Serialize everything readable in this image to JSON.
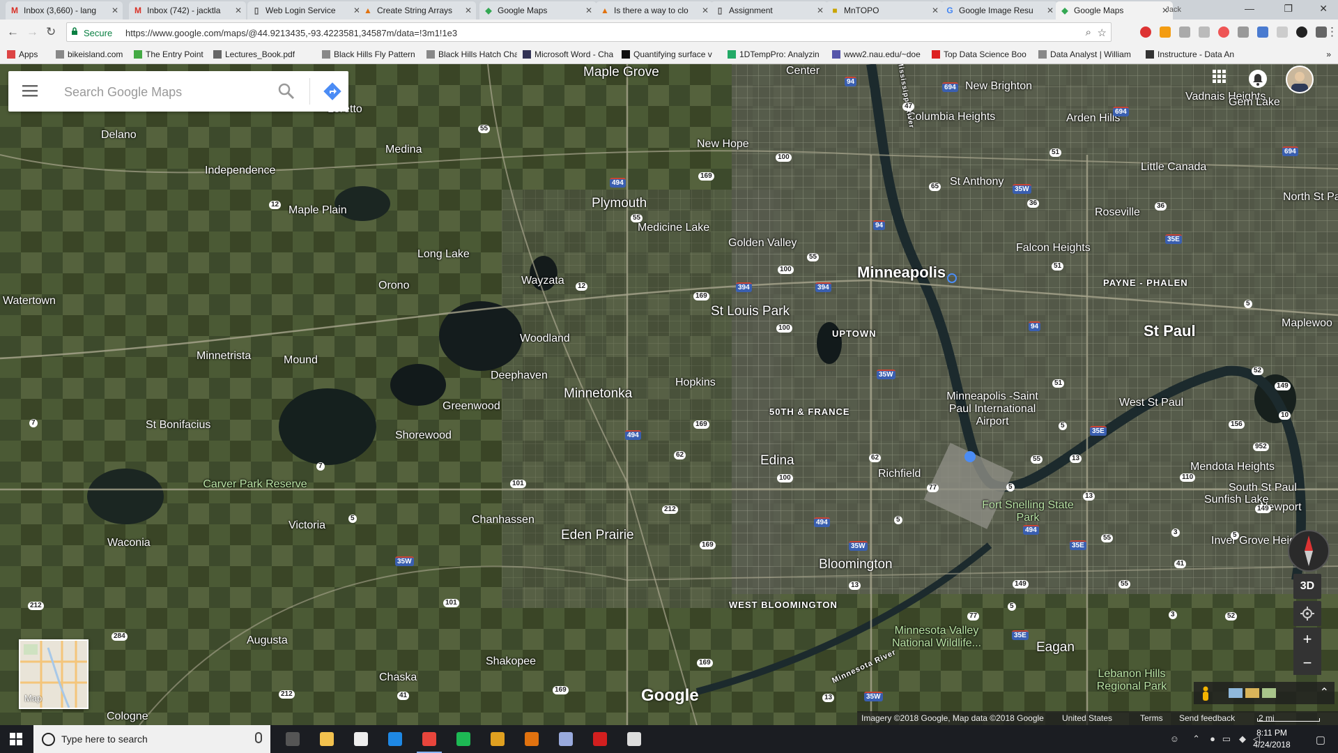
{
  "tabs": [
    {
      "title": "Inbox (3,660) - lang",
      "favicon": "gmail-icon",
      "fav_glyph": "M",
      "fav_color": "#d93025"
    },
    {
      "title": "Inbox (742) - jacktla",
      "favicon": "gmail-icon",
      "fav_glyph": "M",
      "fav_color": "#d93025"
    },
    {
      "title": "Web Login Service",
      "favicon": "page-icon",
      "fav_glyph": "▯",
      "fav_color": "#555"
    },
    {
      "title": "Create String Arrays",
      "favicon": "matlab-icon",
      "fav_glyph": "▲",
      "fav_color": "#e1720f"
    },
    {
      "title": "Google Maps",
      "favicon": "maps-icon",
      "fav_glyph": "◆",
      "fav_color": "#34a853"
    },
    {
      "title": "Is there a way to clo",
      "favicon": "matlab-icon",
      "fav_glyph": "▲",
      "fav_color": "#e1720f"
    },
    {
      "title": "Assignment",
      "favicon": "page-icon",
      "fav_glyph": "▯",
      "fav_color": "#555"
    },
    {
      "title": "MnTOPO",
      "favicon": "mntopo-icon",
      "fav_glyph": "■",
      "fav_color": "#c9a400"
    },
    {
      "title": "Google Image Resu",
      "favicon": "google-icon",
      "fav_glyph": "G",
      "fav_color": "#4285f4"
    },
    {
      "title": "Google Maps",
      "favicon": "maps-icon",
      "fav_glyph": "◆",
      "fav_color": "#34a853"
    }
  ],
  "profile_name": "Jack",
  "address": {
    "secure_label": "Secure",
    "url": "https://www.google.com/maps/@44.9213435,-93.4223581,34587m/data=!3m1!1e3"
  },
  "bookmarks": [
    {
      "label": "Apps",
      "icon": "apps-grid-icon",
      "color": "#d44"
    },
    {
      "label": "bikeisland.com",
      "icon": "page-icon",
      "color": "#888"
    },
    {
      "label": "The Entry Point",
      "icon": "leaf-icon",
      "color": "#4a4"
    },
    {
      "label": "Lectures_Book.pdf",
      "icon": "gear-icon",
      "color": "#666"
    },
    {
      "label": "Black Hills Fly Pattern",
      "icon": "page-icon",
      "color": "#888"
    },
    {
      "label": "Black Hills Hatch Cha",
      "icon": "page-icon",
      "color": "#888"
    },
    {
      "label": "Microsoft Word - Cha",
      "icon": "grid-icon",
      "color": "#335"
    },
    {
      "label": "Quantifying surface v",
      "icon": "w-icon",
      "color": "#111"
    },
    {
      "label": "1DTempPro: Analyzin",
      "icon": "chart-icon",
      "color": "#2a6"
    },
    {
      "label": "www2.nau.edu/~doe",
      "icon": "globe-icon",
      "color": "#55a"
    },
    {
      "label": "Top Data Science Boo",
      "icon": "circle-icon",
      "color": "#d22"
    },
    {
      "label": "Data Analyst | William",
      "icon": "page-icon",
      "color": "#888"
    },
    {
      "label": "Instructure - Data An",
      "icon": "canvas-icon",
      "color": "#333"
    }
  ],
  "search": {
    "placeholder": "Search Google Maps"
  },
  "places": [
    {
      "name": "Maple Grove",
      "cls": "city"
    },
    {
      "name": "Center",
      "cls": ""
    },
    {
      "name": "New Brighton",
      "cls": ""
    },
    {
      "name": "Vadnais Heights",
      "cls": ""
    },
    {
      "name": "Gem Lake",
      "cls": ""
    },
    {
      "name": "Loretto",
      "cls": ""
    },
    {
      "name": "Delano",
      "cls": ""
    },
    {
      "name": "Medina",
      "cls": ""
    },
    {
      "name": "Columbia Heights",
      "cls": ""
    },
    {
      "name": "Arden Hills",
      "cls": ""
    },
    {
      "name": "New Hope",
      "cls": ""
    },
    {
      "name": "Independence",
      "cls": ""
    },
    {
      "name": "Little Canada",
      "cls": ""
    },
    {
      "name": "St Anthony",
      "cls": ""
    },
    {
      "name": "Plymouth",
      "cls": "city"
    },
    {
      "name": "North St Pa",
      "cls": ""
    },
    {
      "name": "Maple Plain",
      "cls": ""
    },
    {
      "name": "Roseville",
      "cls": ""
    },
    {
      "name": "Medicine Lake",
      "cls": ""
    },
    {
      "name": "Golden Valley",
      "cls": ""
    },
    {
      "name": "Falcon Heights",
      "cls": ""
    },
    {
      "name": "Long Lake",
      "cls": ""
    },
    {
      "name": "Minneapolis",
      "cls": "big"
    },
    {
      "name": "Wayzata",
      "cls": ""
    },
    {
      "name": "PAYNE - PHALEN",
      "cls": "small"
    },
    {
      "name": "Orono",
      "cls": ""
    },
    {
      "name": "Watertown",
      "cls": ""
    },
    {
      "name": "St Louis Park",
      "cls": "city"
    },
    {
      "name": "St Paul",
      "cls": "big"
    },
    {
      "name": "Maplewoo",
      "cls": ""
    },
    {
      "name": "UPTOWN",
      "cls": "small"
    },
    {
      "name": "Woodland",
      "cls": ""
    },
    {
      "name": "Minnetrista",
      "cls": ""
    },
    {
      "name": "Mound",
      "cls": ""
    },
    {
      "name": "Deephaven",
      "cls": ""
    },
    {
      "name": "Hopkins",
      "cls": ""
    },
    {
      "name": "Minnetonka",
      "cls": "city"
    },
    {
      "name": "Minneapolis -Saint Paul International Airport",
      "cls": ""
    },
    {
      "name": "West St Paul",
      "cls": ""
    },
    {
      "name": "Greenwood",
      "cls": ""
    },
    {
      "name": "50TH & FRANCE",
      "cls": "small"
    },
    {
      "name": "St Bonifacius",
      "cls": ""
    },
    {
      "name": "Shorewood",
      "cls": ""
    },
    {
      "name": "Edina",
      "cls": "city"
    },
    {
      "name": "Mendota Heights",
      "cls": ""
    },
    {
      "name": "Richfield",
      "cls": ""
    },
    {
      "name": "Carver Park Reserve",
      "cls": "green"
    },
    {
      "name": "South St Paul",
      "cls": ""
    },
    {
      "name": "Sunfish Lake",
      "cls": ""
    },
    {
      "name": "Fort Snelling State Park",
      "cls": "green"
    },
    {
      "name": "Newport",
      "cls": ""
    },
    {
      "name": "Chanhassen",
      "cls": ""
    },
    {
      "name": "Victoria",
      "cls": ""
    },
    {
      "name": "Eden Prairie",
      "cls": "city"
    },
    {
      "name": "Waconia",
      "cls": ""
    },
    {
      "name": "Inver Grove Heights",
      "cls": ""
    },
    {
      "name": "Bloomington",
      "cls": "city"
    },
    {
      "name": "WEST BLOOMINGTON",
      "cls": "small"
    },
    {
      "name": "Minnesota Valley National Wildlife...",
      "cls": "green"
    },
    {
      "name": "Augusta",
      "cls": ""
    },
    {
      "name": "Eagan",
      "cls": "city"
    },
    {
      "name": "Shakopee",
      "cls": ""
    },
    {
      "name": "Chaska",
      "cls": ""
    },
    {
      "name": "Lebanon Hills Regional Park",
      "cls": "green"
    },
    {
      "name": "Cologne",
      "cls": ""
    },
    {
      "name": "Mississippi River",
      "cls": "small"
    },
    {
      "name": "Minnesota River",
      "cls": "small"
    }
  ],
  "shields": [
    {
      "n": "94",
      "s": false
    },
    {
      "n": "694",
      "s": false
    },
    {
      "n": "694",
      "s": false
    },
    {
      "n": "694",
      "s": false
    },
    {
      "n": "47",
      "s": true
    },
    {
      "n": "55",
      "s": true
    },
    {
      "n": "51",
      "s": true
    },
    {
      "n": "100",
      "s": true
    },
    {
      "n": "65",
      "s": true
    },
    {
      "n": "35W",
      "s": false
    },
    {
      "n": "494",
      "s": false
    },
    {
      "n": "169",
      "s": true
    },
    {
      "n": "36",
      "s": true
    },
    {
      "n": "36",
      "s": true
    },
    {
      "n": "12",
      "s": true
    },
    {
      "n": "55",
      "s": true
    },
    {
      "n": "94",
      "s": false
    },
    {
      "n": "35E",
      "s": false
    },
    {
      "n": "55",
      "s": true
    },
    {
      "n": "100",
      "s": true
    },
    {
      "n": "51",
      "s": true
    },
    {
      "n": "12",
      "s": true
    },
    {
      "n": "394",
      "s": false
    },
    {
      "n": "394",
      "s": false
    },
    {
      "n": "169",
      "s": true
    },
    {
      "n": "5",
      "s": true
    },
    {
      "n": "94",
      "s": false
    },
    {
      "n": "100",
      "s": true
    },
    {
      "n": "35W",
      "s": false
    },
    {
      "n": "52",
      "s": true
    },
    {
      "n": "149",
      "s": true
    },
    {
      "n": "51",
      "s": true
    },
    {
      "n": "10",
      "s": true
    },
    {
      "n": "7",
      "s": true
    },
    {
      "n": "494",
      "s": false
    },
    {
      "n": "169",
      "s": true
    },
    {
      "n": "5",
      "s": true
    },
    {
      "n": "35E",
      "s": false
    },
    {
      "n": "156",
      "s": true
    },
    {
      "n": "952",
      "s": true
    },
    {
      "n": "62",
      "s": true
    },
    {
      "n": "62",
      "s": true
    },
    {
      "n": "13",
      "s": true
    },
    {
      "n": "7",
      "s": true
    },
    {
      "n": "55",
      "s": true
    },
    {
      "n": "100",
      "s": true
    },
    {
      "n": "110",
      "s": true
    },
    {
      "n": "101",
      "s": true
    },
    {
      "n": "77",
      "s": true
    },
    {
      "n": "5",
      "s": true
    },
    {
      "n": "13",
      "s": true
    },
    {
      "n": "149",
      "s": true
    },
    {
      "n": "5",
      "s": true
    },
    {
      "n": "5",
      "s": true
    },
    {
      "n": "212",
      "s": true
    },
    {
      "n": "494",
      "s": false
    },
    {
      "n": "494",
      "s": false
    },
    {
      "n": "35W",
      "s": false
    },
    {
      "n": "169",
      "s": true
    },
    {
      "n": "35E",
      "s": false
    },
    {
      "n": "55",
      "s": true
    },
    {
      "n": "3",
      "s": true
    },
    {
      "n": "5",
      "s": true
    },
    {
      "n": "41",
      "s": true
    },
    {
      "n": "35W",
      "s": false
    },
    {
      "n": "13",
      "s": true
    },
    {
      "n": "149",
      "s": true
    },
    {
      "n": "55",
      "s": true
    },
    {
      "n": "5",
      "s": true
    },
    {
      "n": "212",
      "s": true
    },
    {
      "n": "101",
      "s": true
    },
    {
      "n": "77",
      "s": true
    },
    {
      "n": "3",
      "s": true
    },
    {
      "n": "52",
      "s": true
    },
    {
      "n": "284",
      "s": true
    },
    {
      "n": "35E",
      "s": false
    },
    {
      "n": "169",
      "s": true
    },
    {
      "n": "41",
      "s": true
    },
    {
      "n": "212",
      "s": true
    },
    {
      "n": "169",
      "s": true
    },
    {
      "n": "13",
      "s": true
    },
    {
      "n": "35W",
      "s": false
    }
  ],
  "minimap_label": "Map",
  "google_logo": "Google",
  "controls": {
    "three_d": "3D",
    "zoom_in": "+",
    "zoom_out": "−"
  },
  "footer": {
    "attribution": "Imagery ©2018 Google, Map data ©2018 Google",
    "country": "United States",
    "terms": "Terms",
    "feedback": "Send feedback",
    "scale": "2 mi"
  },
  "taskbar": {
    "search_placeholder": "Type here to search",
    "time": "8:11 PM",
    "date": "4/24/2018",
    "apps": [
      {
        "name": "task-view-icon",
        "color": "#555",
        "open": false
      },
      {
        "name": "file-explorer-icon",
        "color": "#f2c14e",
        "open": false
      },
      {
        "name": "home-icon",
        "color": "#eee",
        "open": false
      },
      {
        "name": "edge-icon",
        "color": "#1e88e5",
        "open": false
      },
      {
        "name": "chrome-icon",
        "color": "#e8453c",
        "open": true
      },
      {
        "name": "spotify-icon",
        "color": "#1db954",
        "open": false
      },
      {
        "name": "git-icon",
        "color": "#e0a020",
        "open": false
      },
      {
        "name": "matlab-icon",
        "color": "#e1720f",
        "open": false
      },
      {
        "name": "notes-icon",
        "color": "#9ad",
        "open": false
      },
      {
        "name": "acrobat-icon",
        "color": "#d21f1f",
        "open": false
      },
      {
        "name": "photos-icon",
        "color": "#ddd",
        "open": false
      }
    ]
  }
}
